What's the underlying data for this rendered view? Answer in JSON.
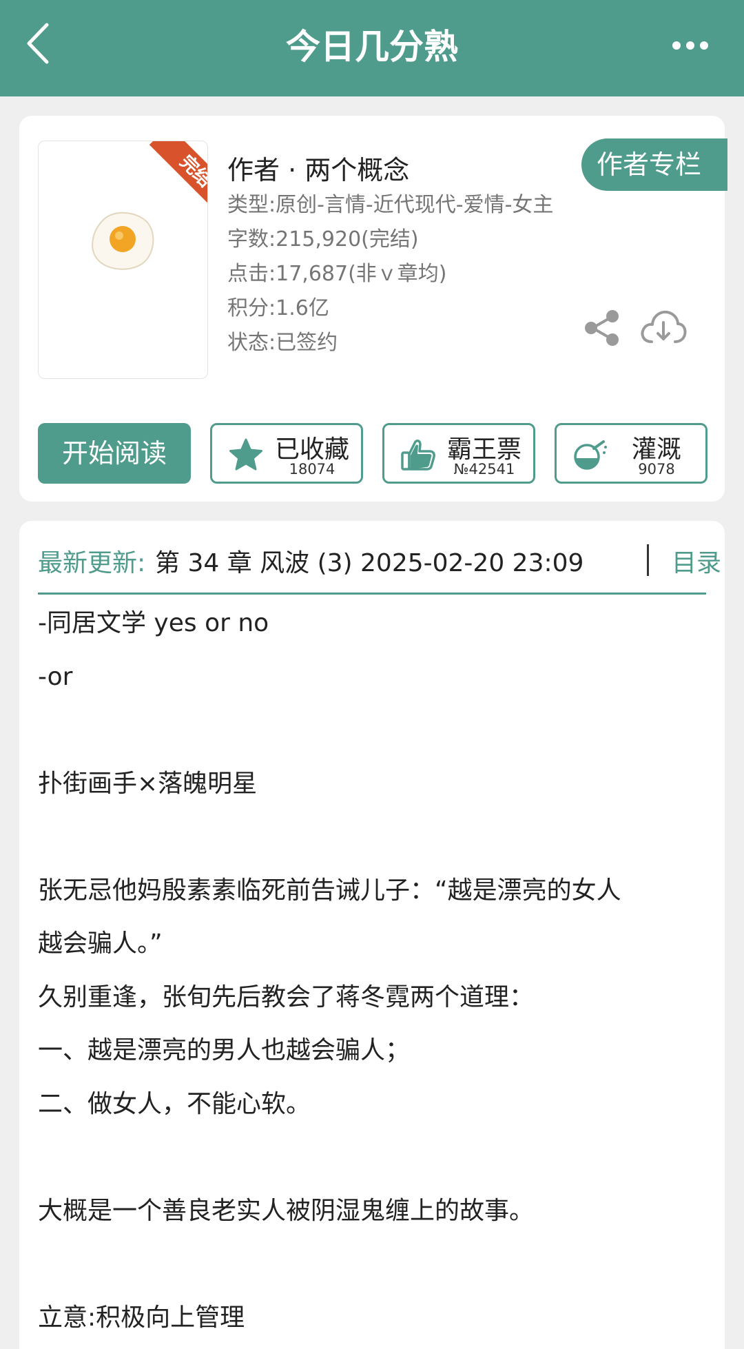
{
  "header": {
    "title": "今日几分熟"
  },
  "book": {
    "status_ribbon": "完结",
    "author_line": "作者 · 两个概念",
    "author_column_label": "作者专栏",
    "meta": [
      "类型:原创-言情-近代现代-爱情-女主",
      "字数:215,920(完结)",
      "点击:17,687(非ｖ章均)",
      "积分:1.6亿",
      "状态:已签约"
    ]
  },
  "actions": {
    "start_reading": "开始阅读",
    "favorite": {
      "label": "已收藏",
      "count": "18074"
    },
    "vote": {
      "label": "霸王票",
      "count": "№42541"
    },
    "nutrient": {
      "label": "灌溉",
      "count": "9078"
    }
  },
  "latest": {
    "label": "最新更新:",
    "text": "第 34 章 风波 (3) 2025-02-20 23:09",
    "toc_label": "目录"
  },
  "description": [
    "-同居文学 yes or no",
    "-or",
    "",
    "扑街画手×落魄明星",
    "",
    "张无忌他妈殷素素临死前告诫儿子：“越是漂亮的女人",
    "越会骗人。”",
    "久别重逢，张旬先后教会了蒋冬霓两个道理：",
    "一、越是漂亮的男人也越会骗人；",
    "二、做女人，不能心软。",
    "",
    "大概是一个善良老实人被阴湿鬼缠上的故事。",
    "",
    "立意:积极向上管理"
  ],
  "colors": {
    "accent": "#4f9b8c",
    "ribbon": "#d8532b",
    "page_bg": "#efefef"
  },
  "icons": [
    "back-icon",
    "more-icon",
    "fried-egg-cover",
    "share-icon",
    "cloud-download-icon",
    "star-icon",
    "thumbs-up-icon",
    "watering-flask-icon"
  ]
}
